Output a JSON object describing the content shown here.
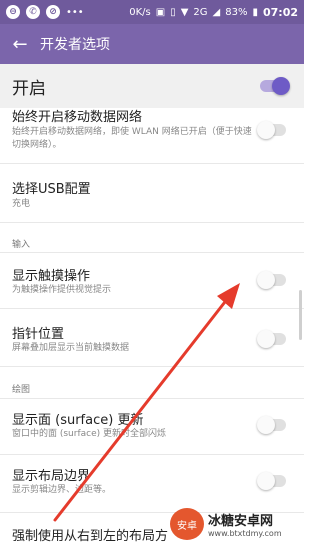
{
  "status_bar": {
    "left_icons": [
      "notification-dot-icon",
      "phone-icon",
      "notification-dot-icon",
      "dots-icon"
    ],
    "speed": "0K/s",
    "network": "2G",
    "battery": "83%",
    "time": "07:02"
  },
  "app_bar": {
    "back_icon": "arrow-left-icon",
    "title": "开发者选项"
  },
  "master": {
    "label": "开启",
    "on": true
  },
  "items": [
    {
      "title": "始终开启移动数据网络",
      "summary": "始终开启移动数据网络，即使 WLAN 网络已开启（便于快速切换网络）。",
      "toggle": false
    },
    {
      "title": "选择USB配置",
      "summary": "充电"
    },
    {
      "title": "显示触摸操作",
      "summary": "为触摸操作提供视觉提示",
      "toggle": false
    },
    {
      "title": "指针位置",
      "summary": "屏幕叠加层显示当前触摸数据",
      "toggle": false
    },
    {
      "title": "显示面 (surface) 更新",
      "summary": "窗口中的面 (surface) 更新时全部闪烁",
      "toggle": false
    },
    {
      "title": "显示布局边界",
      "summary": "显示剪辑边界、边距等。",
      "toggle": false
    },
    {
      "title": "强制使用从右到左的布局方",
      "summary": ""
    }
  ],
  "sections": {
    "input": "输入",
    "drawing": "绘图"
  },
  "watermark": {
    "logo_text": "安卓",
    "name": "冰糖安卓网",
    "url": "www.btxtdmy.com"
  },
  "colors": {
    "status_bar": "#6f5a9c",
    "app_bar": "#7b65ab",
    "accent": "#6e5bc6",
    "arrow": "#e53b2c"
  }
}
